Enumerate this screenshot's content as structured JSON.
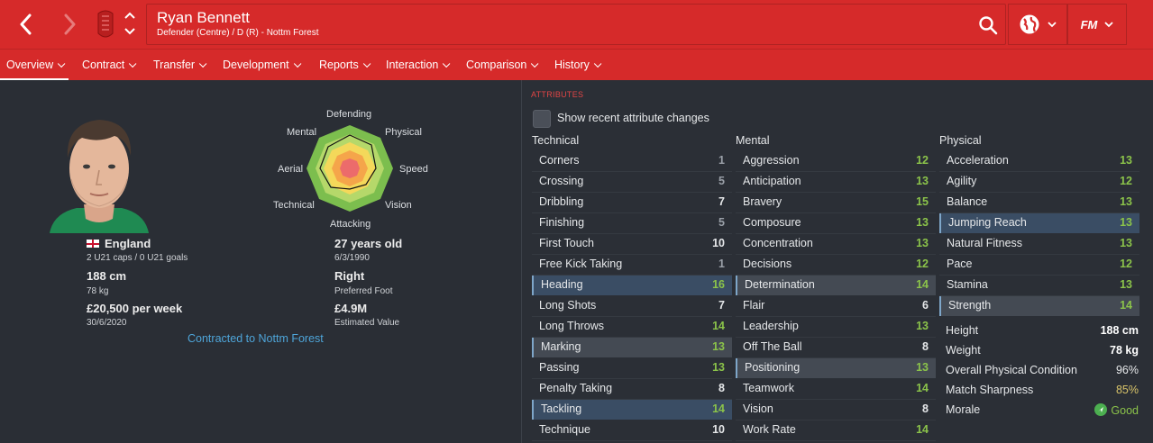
{
  "header": {
    "player_name": "Ryan Bennett",
    "player_subtitle": "Defender (Centre) / D (R) - Nottm Forest",
    "fm_logo": "FM"
  },
  "tabs": [
    {
      "label": "Overview"
    },
    {
      "label": "Contract"
    },
    {
      "label": "Transfer"
    },
    {
      "label": "Development"
    },
    {
      "label": "Reports"
    },
    {
      "label": "Interaction"
    },
    {
      "label": "Comparison"
    },
    {
      "label": "History"
    }
  ],
  "overview": {
    "nationality": "England",
    "caps": "2 U21 caps / 0 U21 goals",
    "height": "188 cm",
    "weight": "78 kg",
    "wage": "£20,500 per week",
    "contract_end": "30/6/2020",
    "age": "27 years old",
    "dob": "6/3/1990",
    "preferred_foot": "Right",
    "preferred_foot_label": "Preferred Foot",
    "value": "£4.9M",
    "value_label": "Estimated Value",
    "contract_status": "Contracted to Nottm Forest"
  },
  "radar": {
    "labels": {
      "defending": "Defending",
      "physical": "Physical",
      "speed": "Speed",
      "vision": "Vision",
      "attacking": "Attacking",
      "technical": "Technical",
      "aerial": "Aerial",
      "mental": "Mental"
    }
  },
  "attributes": {
    "title": "ATTRIBUTES",
    "show_changes_label": "Show recent attribute changes",
    "technical_header": "Technical",
    "mental_header": "Mental",
    "physical_header": "Physical",
    "technical": [
      {
        "name": "Corners",
        "value": "1"
      },
      {
        "name": "Crossing",
        "value": "5"
      },
      {
        "name": "Dribbling",
        "value": "7"
      },
      {
        "name": "Finishing",
        "value": "5"
      },
      {
        "name": "First Touch",
        "value": "10"
      },
      {
        "name": "Free Kick Taking",
        "value": "1"
      },
      {
        "name": "Heading",
        "value": "16"
      },
      {
        "name": "Long Shots",
        "value": "7"
      },
      {
        "name": "Long Throws",
        "value": "14"
      },
      {
        "name": "Marking",
        "value": "13"
      },
      {
        "name": "Passing",
        "value": "13"
      },
      {
        "name": "Penalty Taking",
        "value": "8"
      },
      {
        "name": "Tackling",
        "value": "14"
      },
      {
        "name": "Technique",
        "value": "10"
      }
    ],
    "mental": [
      {
        "name": "Aggression",
        "value": "12"
      },
      {
        "name": "Anticipation",
        "value": "13"
      },
      {
        "name": "Bravery",
        "value": "15"
      },
      {
        "name": "Composure",
        "value": "13"
      },
      {
        "name": "Concentration",
        "value": "13"
      },
      {
        "name": "Decisions",
        "value": "12"
      },
      {
        "name": "Determination",
        "value": "14"
      },
      {
        "name": "Flair",
        "value": "6"
      },
      {
        "name": "Leadership",
        "value": "13"
      },
      {
        "name": "Off The Ball",
        "value": "8"
      },
      {
        "name": "Positioning",
        "value": "13"
      },
      {
        "name": "Teamwork",
        "value": "14"
      },
      {
        "name": "Vision",
        "value": "8"
      },
      {
        "name": "Work Rate",
        "value": "14"
      }
    ],
    "physical": [
      {
        "name": "Acceleration",
        "value": "13"
      },
      {
        "name": "Agility",
        "value": "12"
      },
      {
        "name": "Balance",
        "value": "13"
      },
      {
        "name": "Jumping Reach",
        "value": "13"
      },
      {
        "name": "Natural Fitness",
        "value": "13"
      },
      {
        "name": "Pace",
        "value": "12"
      },
      {
        "name": "Stamina",
        "value": "13"
      },
      {
        "name": "Strength",
        "value": "14"
      }
    ],
    "physical_info": [
      {
        "name": "Height",
        "value": "188 cm"
      },
      {
        "name": "Weight",
        "value": "78 kg"
      },
      {
        "name": "Overall Physical Condition",
        "value": "96%"
      },
      {
        "name": "Match Sharpness",
        "value": "85%"
      },
      {
        "name": "Morale",
        "value": "Good"
      }
    ]
  },
  "colors": {
    "header_red": "#d62a2a",
    "panel_bg": "#2a2e35",
    "value_green": "#8bc34a",
    "value_white": "#e6e8ea",
    "value_grey": "#9aa0a8",
    "link_blue": "#4ea5d9",
    "warning_yellow": "#d9c46a"
  }
}
